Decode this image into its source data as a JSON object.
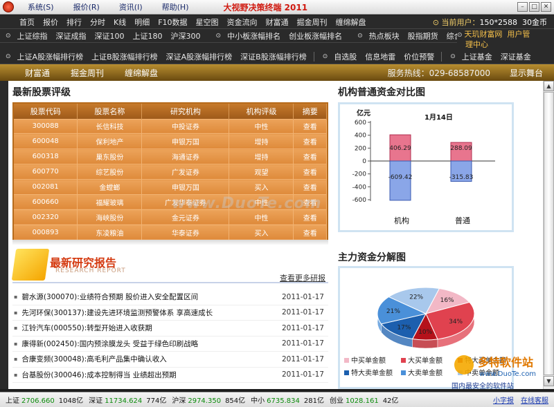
{
  "menubar": {
    "items": [
      "系统(S)",
      "报价(R)",
      "资讯(I)",
      "帮助(H)"
    ],
    "app_title": "大视野决策终端 2011"
  },
  "nav1": {
    "items": [
      "首页",
      "报价",
      "排行",
      "分时",
      "K线",
      "明细",
      "F10数据",
      "星空图",
      "资金流向",
      "财富通",
      "掘金周刊",
      "缠绵解盘"
    ],
    "user_label": "当前用户：",
    "user_value": "150*2588",
    "coins": "30金币"
  },
  "nav2": {
    "items": [
      "上证综指",
      "深证成指",
      "深证100",
      "上证180",
      "沪深300"
    ],
    "items_b": [
      "中小板涨幅排名",
      "创业板涨幅排名"
    ],
    "items_c": [
      "热点板块",
      "股指期货",
      "综合资讯"
    ]
  },
  "right_links": {
    "line1": "天玑财富网",
    "line1b": "用户管",
    "line2": "理中心"
  },
  "nav3": {
    "items": [
      "上证A股涨幅排行榜",
      "上证B股涨幅排行榜",
      "深证A股涨幅排行榜",
      "深证B股涨幅排行榜"
    ],
    "items_b": [
      "自选股",
      "信息地雷",
      "价位预警"
    ],
    "items_c": [
      "上证基金",
      "深证基金"
    ]
  },
  "sub_toolbar": {
    "items": [
      "财富通",
      "掘金周刊",
      "缠绵解盘"
    ],
    "hotline": "服务热线：029-68587000",
    "stage": "显示舞台"
  },
  "rating": {
    "title": "最新股票评级",
    "headers": [
      "股票代码",
      "股票名称",
      "研究机构",
      "机构评级",
      "摘要"
    ],
    "rows": [
      [
        "300088",
        "长信科技",
        "中投证券",
        "中性",
        "查看"
      ],
      [
        "600048",
        "保利地产",
        "申银万国",
        "增持",
        "查看"
      ],
      [
        "600318",
        "巢东股份",
        "海通证券",
        "增持",
        "查看"
      ],
      [
        "600770",
        "综艺股份",
        "广发证券",
        "观望",
        "查看"
      ],
      [
        "002081",
        "金螳螂",
        "申银万国",
        "买入",
        "查看"
      ],
      [
        "600660",
        "福耀玻璃",
        "广发华泰证券",
        "中性",
        "查看"
      ],
      [
        "002320",
        "海峡股份",
        "金元证券",
        "中性",
        "查看"
      ],
      [
        "000893",
        "东凌粮油",
        "华泰证券",
        "买入",
        "查看"
      ]
    ]
  },
  "report": {
    "title": "最新研究报告",
    "subtitle": "RESEARCH REPORT",
    "more": "查看更多研报",
    "items": [
      {
        "text": "碧水源(300070):业绩符合预期 股价进入安全配置区间",
        "date": "2011-01-17"
      },
      {
        "text": "先河环保(300137):建设先进环境监测预警体系 享高速成长",
        "date": "2011-01-17"
      },
      {
        "text": "江铃汽车(000550):转型开始进入收获期",
        "date": "2011-01-17"
      },
      {
        "text": "康得新(002450):国内预涂膜龙头 受益于绿色印刷战略",
        "date": "2011-01-17"
      },
      {
        "text": "合康变频(300048):高毛利产品集中确认收入",
        "date": "2011-01-17"
      },
      {
        "text": "台基股份(300046):成本控制得当 业绩超出预期",
        "date": "2011-01-17"
      }
    ]
  },
  "flow_chart": {
    "title": "机构普通资金对比图",
    "unit": "亿元",
    "date": "1月14日",
    "ticks": [
      "600",
      "400",
      "200",
      "0",
      "-200",
      "-400",
      "-600"
    ],
    "labels_pos": [
      "406.29",
      "288.09"
    ],
    "labels_neg": [
      "-609.42",
      "-315.83"
    ]
  },
  "chart_data": [
    {
      "type": "bar",
      "title": "机构普通资金对比图",
      "ylabel": "亿元",
      "categories": [
        "机构",
        "普通"
      ],
      "series": [
        {
          "values": [
            406.29,
            288.09
          ]
        },
        {
          "values": [
            -609.42,
            -315.83
          ]
        }
      ],
      "ylim": [
        -600,
        600
      ]
    },
    {
      "type": "pie",
      "title": "主力资金分解图",
      "labels": [
        "中买单金额",
        "大买单金额",
        "特大买单金额",
        "特大卖单金额",
        "大卖单金额",
        "中卖单金额"
      ],
      "values": [
        16,
        34,
        10,
        17,
        21,
        22
      ],
      "colors": [
        "#f2b8c6",
        "#e0424f",
        "#b5121b",
        "#1c5fae",
        "#4a90d9",
        "#a8c8ec"
      ]
    }
  ],
  "mix_chart": {
    "title": "主力资金分解图",
    "slice_labels": [
      "16%",
      "34%",
      "10%",
      "17%",
      "21%",
      "22%"
    ],
    "legend": [
      "中买单金额",
      "大买单金额",
      "特大买单金额",
      "特大卖单金额",
      "大卖单金额",
      "中卖单金额"
    ]
  },
  "watermark": "www.DuoTe.com",
  "logo_watermark": {
    "brand": "多特软件站",
    "url": "www.DuoTe.com",
    "slogan": "国内最安全的软件站"
  },
  "statusbar": {
    "items": [
      {
        "name": "上证",
        "value": "2706.660",
        "amount": "1048亿"
      },
      {
        "name": "深证",
        "value": "11734.624",
        "amount": "774亿"
      },
      {
        "name": "沪深",
        "value": "2974.350",
        "amount": "854亿"
      },
      {
        "name": "中小",
        "value": "6735.834",
        "amount": "281亿"
      },
      {
        "name": "创业",
        "value": "1028.161",
        "amount": "42亿"
      }
    ],
    "links": [
      "小字报",
      "在线客服"
    ]
  },
  "colors": {
    "accent": "#e89a47",
    "toolbar": "#8a6418",
    "up": "#d01a10",
    "status_value": "#0a8a0a"
  }
}
